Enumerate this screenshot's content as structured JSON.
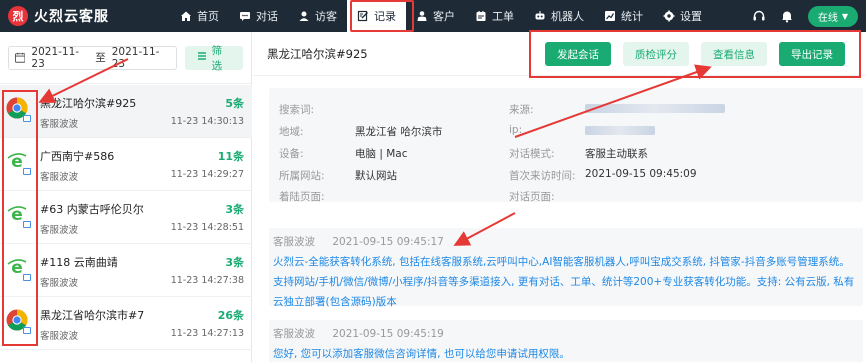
{
  "app": {
    "logo_char": "烈",
    "name": "火烈云客服"
  },
  "nav": [
    {
      "label": "首页",
      "icon": "home-icon"
    },
    {
      "label": "对话",
      "icon": "chat-icon"
    },
    {
      "label": "访客",
      "icon": "visitor-icon"
    },
    {
      "label": "记录",
      "icon": "record-icon",
      "active": true
    },
    {
      "label": "客户",
      "icon": "customer-icon"
    },
    {
      "label": "工单",
      "icon": "ticket-icon"
    },
    {
      "label": "机器人",
      "icon": "robot-icon"
    },
    {
      "label": "统计",
      "icon": "stats-icon"
    },
    {
      "label": "设置",
      "icon": "settings-icon"
    }
  ],
  "topright": {
    "status": "在线"
  },
  "filter": {
    "date_from": "2021-11-23",
    "date_sep": "至",
    "date_to": "2021-11-23",
    "filter_label": "筛选"
  },
  "sessions": [
    {
      "title": "黑龙江哈尔滨#925",
      "count": "5条",
      "agent": "客服波波",
      "time": "11-23 14:30:13",
      "browser": "chrome"
    },
    {
      "title": "广西南宁#586",
      "count": "11条",
      "agent": "客服波波",
      "time": "11-23 14:29:27",
      "browser": "ie"
    },
    {
      "title": "#63 内蒙古呼伦贝尔",
      "count": "3条",
      "agent": "客服波波",
      "time": "11-23 14:28:51",
      "browser": "ie"
    },
    {
      "title": "#118 云南曲靖",
      "count": "3条",
      "agent": "客服波波",
      "time": "11-23 14:27:38",
      "browser": "ie"
    },
    {
      "title": "黑龙江省哈尔滨市#7",
      "count": "26条",
      "agent": "客服波波",
      "time": "11-23 14:27:13",
      "browser": "chrome"
    }
  ],
  "detail": {
    "title": "黑龙江哈尔滨#925",
    "actions": [
      "发起会话",
      "质检评分",
      "查看信息",
      "导出记录"
    ],
    "info": {
      "search_label": "搜索词:",
      "search_value": "",
      "source_label": "来源:",
      "region_label": "地域:",
      "region_value": "黑龙江省 哈尔滨市",
      "ip_label": "ip:",
      "device_label": "设备:",
      "device_value": "电脑 | Mac",
      "mode_label": "对话模式:",
      "mode_value": "客服主动联系",
      "site_label": "所属网站:",
      "site_value": "默认网站",
      "first_visit_label": "首次来访时间:",
      "first_visit_value": "2021-09-15 09:45:09",
      "landing_label": "着陆页面:",
      "landing_value": "",
      "chat_page_label": "对话页面:",
      "chat_page_value": ""
    },
    "messages": [
      {
        "sender": "客服波波",
        "time": "2021-09-15 09:45:17",
        "text": "火烈云-全能获客转化系统, 包括在线客服系统,云呼叫中心,AI智能客服机器人,呼叫宝成交系统, 抖管家-抖音多账号管理系统。支持网站/手机/微信/微博/小程序/抖音等多渠道接入, 更有对话、工单、统计等200+专业获客转化功能。支持: 公有云版, 私有云独立部署(包含源码)版本"
      },
      {
        "sender": "客服波波",
        "time": "2021-09-15 09:45:19",
        "text": "您好, 您可以添加客服微信咨询详情, 也可以给您申请试用权限。"
      }
    ]
  },
  "colors": {
    "topbar": "#1e2a36",
    "accent": "#1aab73",
    "annotation": "#e53935",
    "message_text": "#1e88e5"
  }
}
